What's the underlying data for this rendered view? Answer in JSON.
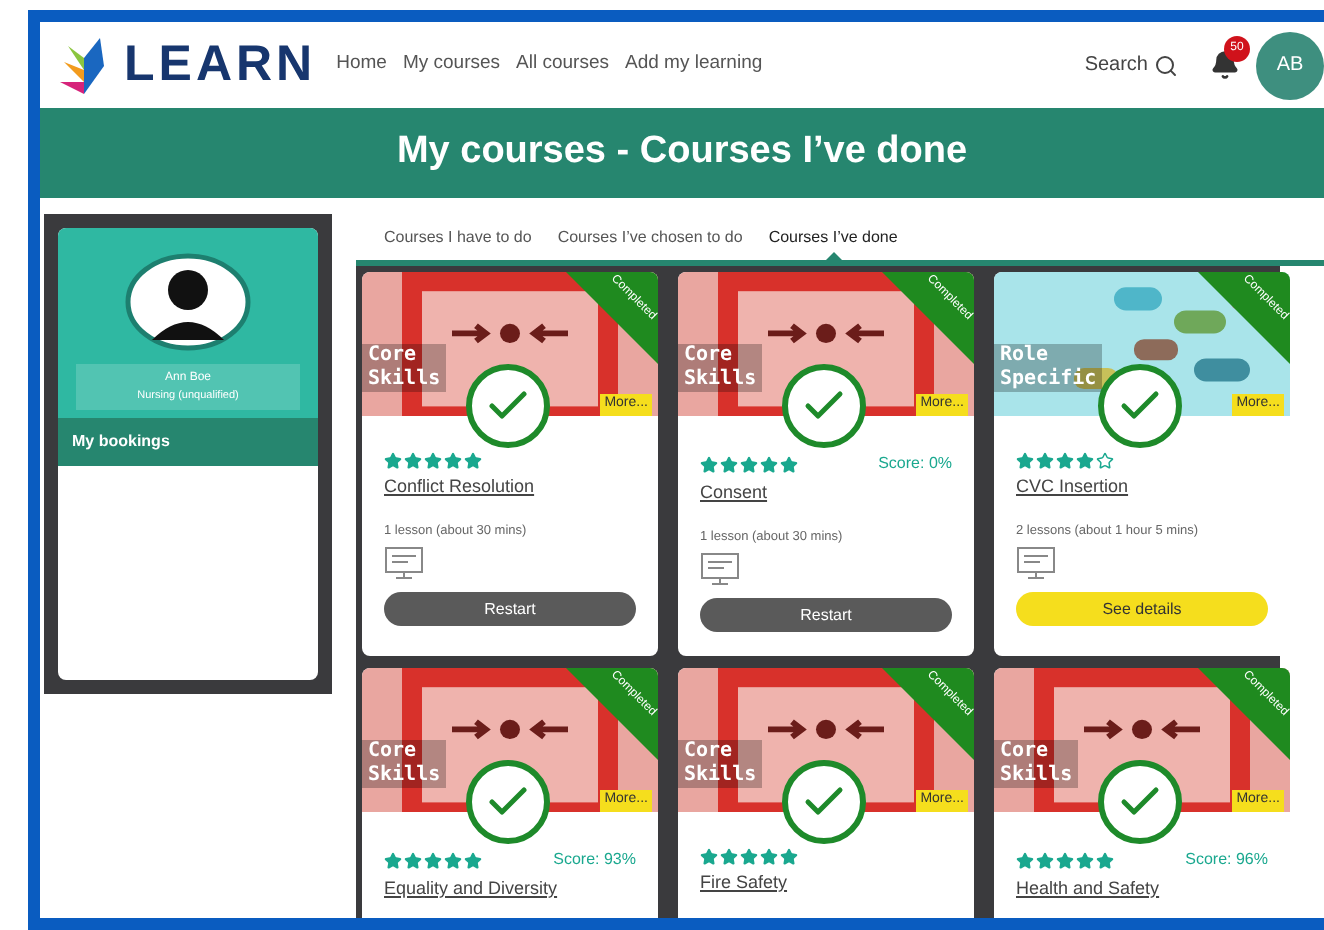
{
  "header": {
    "logo": "LEARN",
    "nav": [
      {
        "label": "Home"
      },
      {
        "label": "My courses"
      },
      {
        "label": "All courses"
      },
      {
        "label": "Add my learning"
      }
    ],
    "search": "Search",
    "notifications": "50",
    "avatar": "AB"
  },
  "banner": {
    "title": "My courses - Courses I’ve done"
  },
  "sidebar": {
    "name": "Ann Boe",
    "role": "Nursing (unqualified)",
    "items": [
      {
        "label": "My bookings"
      }
    ]
  },
  "tabs": [
    {
      "label": "Courses I have to do",
      "selected": false
    },
    {
      "label": "Courses I’ve chosen to do",
      "selected": false
    },
    {
      "label": "Courses I’ve done",
      "selected": true
    }
  ],
  "cards": [
    {
      "kind": "core",
      "category_line_1": "Core",
      "category_line_2": "Skills",
      "ribbon": "Completed",
      "more": "More...",
      "stars": 5,
      "title": "Conflict Resolution",
      "lessons": "1 lesson (about 30 mins)",
      "button": {
        "label": "Restart",
        "kind": "restart"
      }
    },
    {
      "kind": "core",
      "category_line_1": "Core",
      "category_line_2": "Skills",
      "ribbon": "Completed",
      "more": "More...",
      "stars": 5,
      "score": "Score: 0%",
      "title": "Consent",
      "lessons": "1 lesson (about 30 mins)",
      "button": {
        "label": "Restart",
        "kind": "restart"
      }
    },
    {
      "kind": "role",
      "category_line_1": "Role",
      "category_line_2": "Specific",
      "ribbon": "Completed",
      "more": "More...",
      "stars": 4,
      "title": "CVC Insertion",
      "lessons": "2 lessons (about 1 hour 5 mins)",
      "button": {
        "label": "See details",
        "kind": "details"
      }
    },
    {
      "kind": "core",
      "category_line_1": "Core",
      "category_line_2": "Skills",
      "ribbon": "Completed",
      "more": "More...",
      "stars": 5,
      "score": "Score: 93%",
      "title": "Equality and Diversity"
    },
    {
      "kind": "core",
      "category_line_1": "Core",
      "category_line_2": "Skills",
      "ribbon": "Completed",
      "more": "More...",
      "stars": 5,
      "title": "Fire Safety"
    },
    {
      "kind": "core",
      "category_line_1": "Core",
      "category_line_2": "Skills",
      "ribbon": "Completed",
      "more": "More...",
      "stars": 5,
      "score": "Score: 96%",
      "title": "Health and Safety"
    }
  ]
}
